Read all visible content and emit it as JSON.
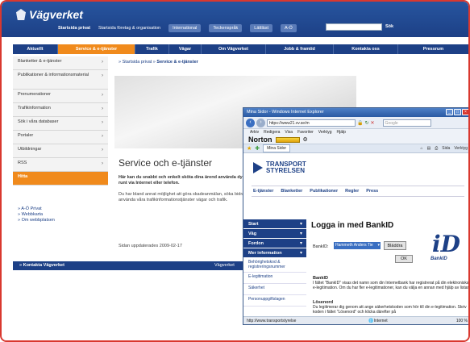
{
  "vv": {
    "logo": "Vägverket",
    "topnav": [
      "Startsida privat",
      "Startsida företag & organisation",
      "International",
      "Teckenspråk",
      "Lättläst",
      "A-Ö"
    ],
    "search_button": "Sök",
    "mainnav": [
      "Aktuellt",
      "Service & e-tjänster",
      "Trafik",
      "Vägar",
      "Om Vägverket",
      "Jobb & framtid",
      "Kontakta oss",
      "Pressrum"
    ],
    "sidebar": [
      "Blanketter & e-tjänster",
      "Publikationer & informationsmaterial",
      "Prenumerationer",
      "Trafikinformation",
      "Sök i våra databaser",
      "Portaler",
      "Utbildningar",
      "RSS",
      "Hitta"
    ],
    "links": [
      "A-Ö Privat",
      "Webbkarta",
      "Om webbplatsen"
    ],
    "breadcrumb": {
      "first": "Startsida privat",
      "current": "Service & e-tjänster"
    },
    "hero_title": "Service och e-tjänster",
    "intro": "Här kan du snabbt och enkelt sköta dina ärend använda dygnet runt via Internet eller telefon.",
    "body": "Du har bland annat möjlighet att göra skadeanmälan, söka bidrag, använda våra trafikinformationstjänster vägar och trafik.",
    "updated": "Sidan uppdaterades 2009-02-17",
    "bottom_left": "Kontakta Vägverket",
    "bottom_right": "Vägverket"
  },
  "ie": {
    "title": "Mina Sidor - Windows Internet Explorer",
    "url": "https://www21.vv.se/m",
    "search_placeholder": "Google",
    "menu": [
      "Arkiv",
      "Redigera",
      "Visa",
      "Favoriter",
      "Verktyg",
      "Hjälp"
    ],
    "norton": "Norton",
    "tab": "Mina Sidor",
    "tools": [
      "Sida",
      "Verktyg"
    ],
    "status_url": "http://www.transportstyrelse",
    "status_zone": "Internet",
    "status_zoom": "100 %"
  },
  "ts": {
    "logo_line1": "TRANSPORT",
    "logo_line2": "STYRELSEN",
    "nav": [
      "E-tjänster",
      "Blanketter",
      "Publikationer",
      "Regler",
      "Press"
    ],
    "side_blue": [
      "Start",
      "Väg",
      "Fordon",
      "Mer information"
    ],
    "side_sub": [
      "Behörighetskod & registreringsnummer",
      "E-legitimation",
      "Säkerhet",
      "Personuppgiftslagen"
    ],
    "heading": "Logga in med BankID",
    "bankid_label": "BankID:",
    "select_value": "Hammeth Anders Tie",
    "btn_browse": "Bläddra",
    "btn_ok": "OK",
    "bankid_logo": "BankID",
    "p1_title": "BankID",
    "p1": "I fältet \"BankID\" visas det namn som din Internetbank har registrerat på din elektroniska e-legitimation. Om du har fler e-legitimationer, kan du välja en annan med hjälp av listan.",
    "p2_title": "Lösenord",
    "p2": "Du legitimerar dig genom att ange säkerhetskoden som hör till din e-legitimation. Skriv koden i fältet \"Lösenord\" och klicka därefter på"
  }
}
